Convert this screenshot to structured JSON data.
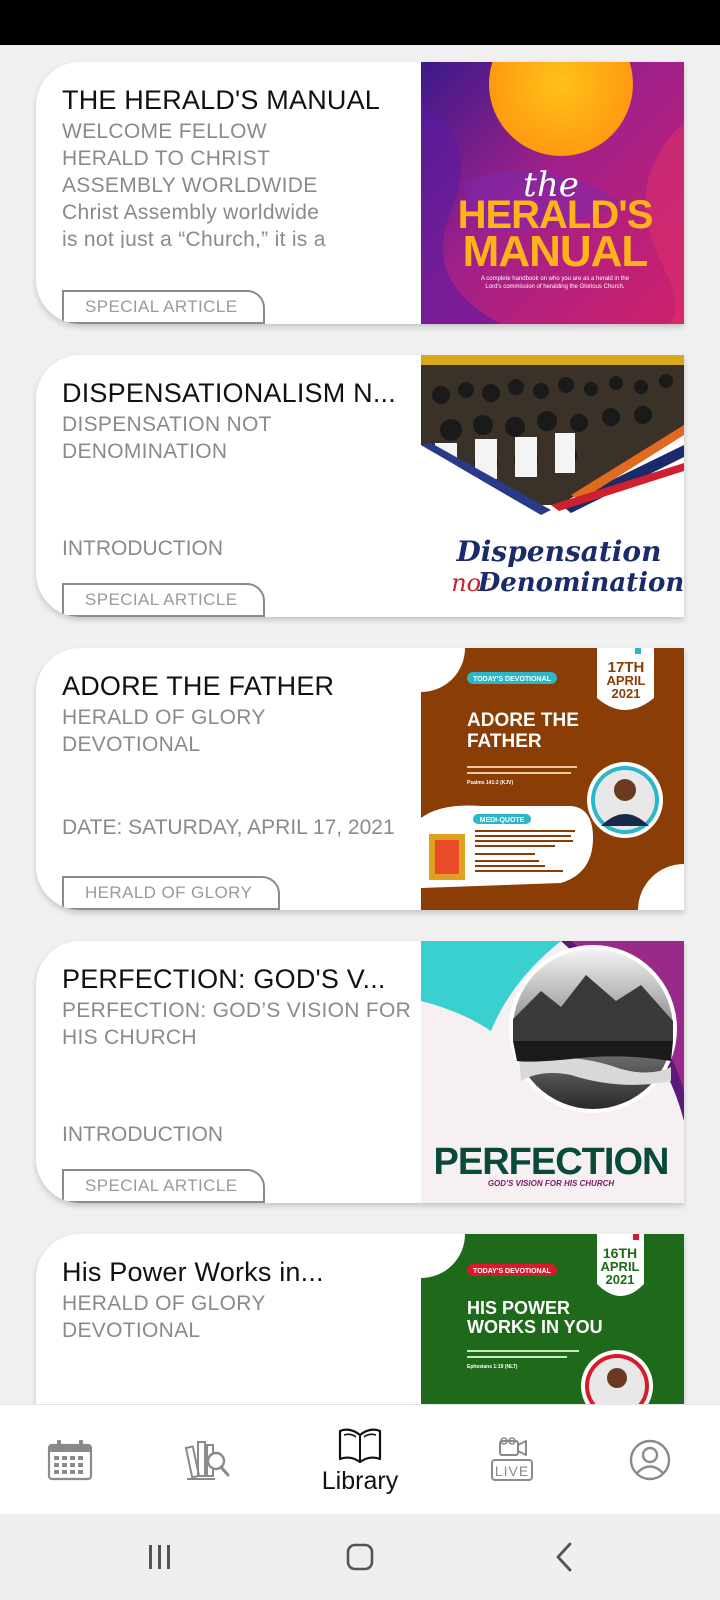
{
  "cards": [
    {
      "title": "THE HERALD'S MANUAL",
      "subtitle_lines": [
        "WELCOME FELLOW",
        "HERALD TO CHRIST",
        "ASSEMBLY WORLDWIDE",
        "Christ Assembly worldwide",
        "is not just a “Church,” it is a"
      ],
      "tag": "SPECIAL ARTICLE",
      "image": {
        "script_word": "the",
        "headline_1": "HERALD'S",
        "headline_2": "MANUAL",
        "caption_1": "A complete handbook on who you are as a herald in the",
        "caption_2": "Lord's commission of heralding the Glorious Church."
      }
    },
    {
      "title": "DISPENSATIONALISM N...",
      "subtitle_lines": [
        "DISPENSATION NOT",
        "DENOMINATION"
      ],
      "body": "INTRODUCTION",
      "tag": "SPECIAL ARTICLE",
      "image": {
        "line_1": "Dispensation",
        "line_2_red": "not",
        "line_2_blue": "Denomination"
      }
    },
    {
      "title": "ADORE THE FATHER",
      "subtitle_lines": [
        "HERALD OF GLORY",
        "DEVOTIONAL"
      ],
      "body": "DATE: SATURDAY, APRIL 17, 2021",
      "tag": "HERALD OF GLORY",
      "image": {
        "badge": "TODAY'S DEVOTIONAL",
        "date_1": "17TH",
        "date_2": "APRIL",
        "date_3": "2021",
        "headline_1": "ADORE THE",
        "headline_2": "FATHER",
        "quote_badge": "MEDI-QUOTE",
        "scripture": "Psalms 141:2 (KJV)"
      }
    },
    {
      "title": "PERFECTION: GOD'S V...",
      "subtitle_lines": [
        "PERFECTION: GOD’S VISION FOR",
        "HIS CHURCH"
      ],
      "body": "INTRODUCTION",
      "tag": "SPECIAL ARTICLE",
      "image": {
        "headline": "PERFECTION",
        "caption": "GOD'S VISION FOR HIS CHURCH"
      }
    },
    {
      "title": "His Power Works in...",
      "subtitle_lines": [
        "HERALD OF GLORY",
        "DEVOTIONAL"
      ],
      "image": {
        "badge": "TODAY'S DEVOTIONAL",
        "date_1": "16TH",
        "date_2": "APRIL",
        "date_3": "2021",
        "headline_1": "HIS POWER",
        "headline_2": "WORKS IN YOU",
        "scripture": "Ephesians 1:19 (NLT)"
      }
    }
  ],
  "bottom_nav": {
    "items": [
      {
        "icon": "calendar-icon",
        "label": ""
      },
      {
        "icon": "books-search-icon",
        "label": ""
      },
      {
        "icon": "open-book-icon",
        "label": "Library"
      },
      {
        "icon": "live-video-icon",
        "label": "LIVE"
      },
      {
        "icon": "profile-icon",
        "label": ""
      }
    ],
    "active_color": "#111111",
    "inactive_color": "#8a8a8a"
  },
  "system_nav": {
    "items": [
      "recent-apps-icon",
      "home-icon",
      "back-icon"
    ]
  }
}
